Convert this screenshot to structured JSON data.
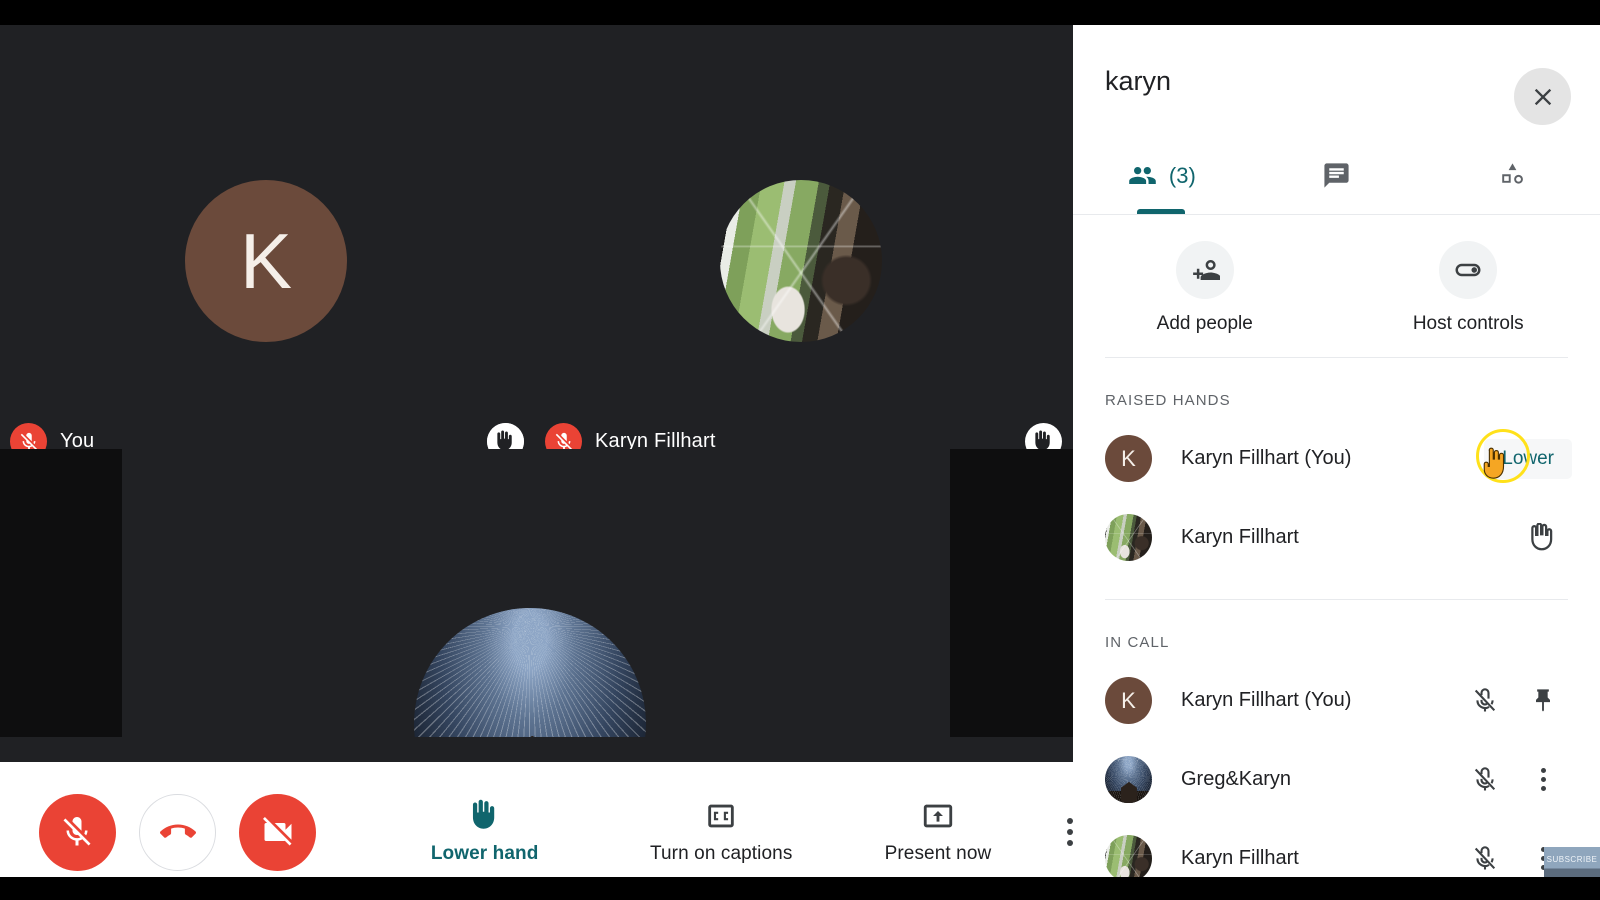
{
  "meeting": {
    "title": "karyn",
    "stage": {
      "tiles": [
        {
          "name_label": "You",
          "avatar_type": "initial",
          "initial": "K",
          "avatar_color": "#6b4a3b",
          "muted": true,
          "hand_raised": true
        },
        {
          "name_label": "Karyn Fillhart",
          "avatar_type": "photo-window",
          "muted": true,
          "hand_raised": true
        },
        {
          "name_label": "",
          "avatar_type": "photo-night",
          "muted": false,
          "hand_raised": false
        }
      ]
    }
  },
  "bottom_bar": {
    "mic_button": {
      "name": "microphone-off",
      "state": "muted"
    },
    "hangup_button": {
      "name": "leave-call"
    },
    "camera_button": {
      "name": "camera-off",
      "state": "off"
    },
    "actions": [
      {
        "label": "Lower hand",
        "icon": "raised-hand-icon",
        "active": true
      },
      {
        "label": "Turn on captions",
        "icon": "closed-caption-icon",
        "active": false
      },
      {
        "label": "Present now",
        "icon": "present-screen-icon",
        "active": false
      }
    ],
    "more_label": "More options"
  },
  "panel": {
    "title": "karyn",
    "close_label": "Close",
    "tabs": [
      {
        "id": "people",
        "icon": "people-icon",
        "count": "(3)",
        "active": true
      },
      {
        "id": "chat",
        "icon": "chat-bubble-icon",
        "count": "",
        "active": false
      },
      {
        "id": "activities",
        "icon": "activities-shapes-icon",
        "count": "",
        "active": false
      }
    ],
    "quick_actions": [
      {
        "label": "Add people",
        "icon": "person-add-icon"
      },
      {
        "label": "Host controls",
        "icon": "toggle-switch-icon"
      }
    ],
    "raised_hands": {
      "section_label": "Raised hands",
      "items": [
        {
          "name": "Karyn Fillhart (You)",
          "avatar_type": "initial",
          "initial": "K",
          "avatar_color": "#6b4a3b",
          "action_type": "lower-button",
          "action_label": "Lower",
          "highlighted": true
        },
        {
          "name": "Karyn Fillhart",
          "avatar_type": "photo-window",
          "action_type": "hand-icon",
          "action_label": "Raised hand",
          "highlighted": false
        }
      ]
    },
    "in_call": {
      "section_label": "In call",
      "items": [
        {
          "name": "Karyn Fillhart (You)",
          "avatar_type": "initial",
          "initial": "K",
          "avatar_color": "#6b4a3b",
          "muted": true,
          "second_action": "pin-icon"
        },
        {
          "name": "Greg&Karyn",
          "avatar_type": "photo-night",
          "muted": true,
          "second_action": "more-vertical-icon"
        },
        {
          "name": "Karyn Fillhart",
          "avatar_type": "photo-window",
          "muted": true,
          "second_action": "more-vertical-icon"
        }
      ]
    }
  },
  "watermark": {
    "text": "SUBSCRIBE"
  },
  "colors": {
    "accent_teal": "#10656d",
    "danger_red": "#ea4335",
    "stage_bg": "#202124",
    "panel_bg": "#ffffff",
    "highlight_yellow": "#ffe11a"
  }
}
